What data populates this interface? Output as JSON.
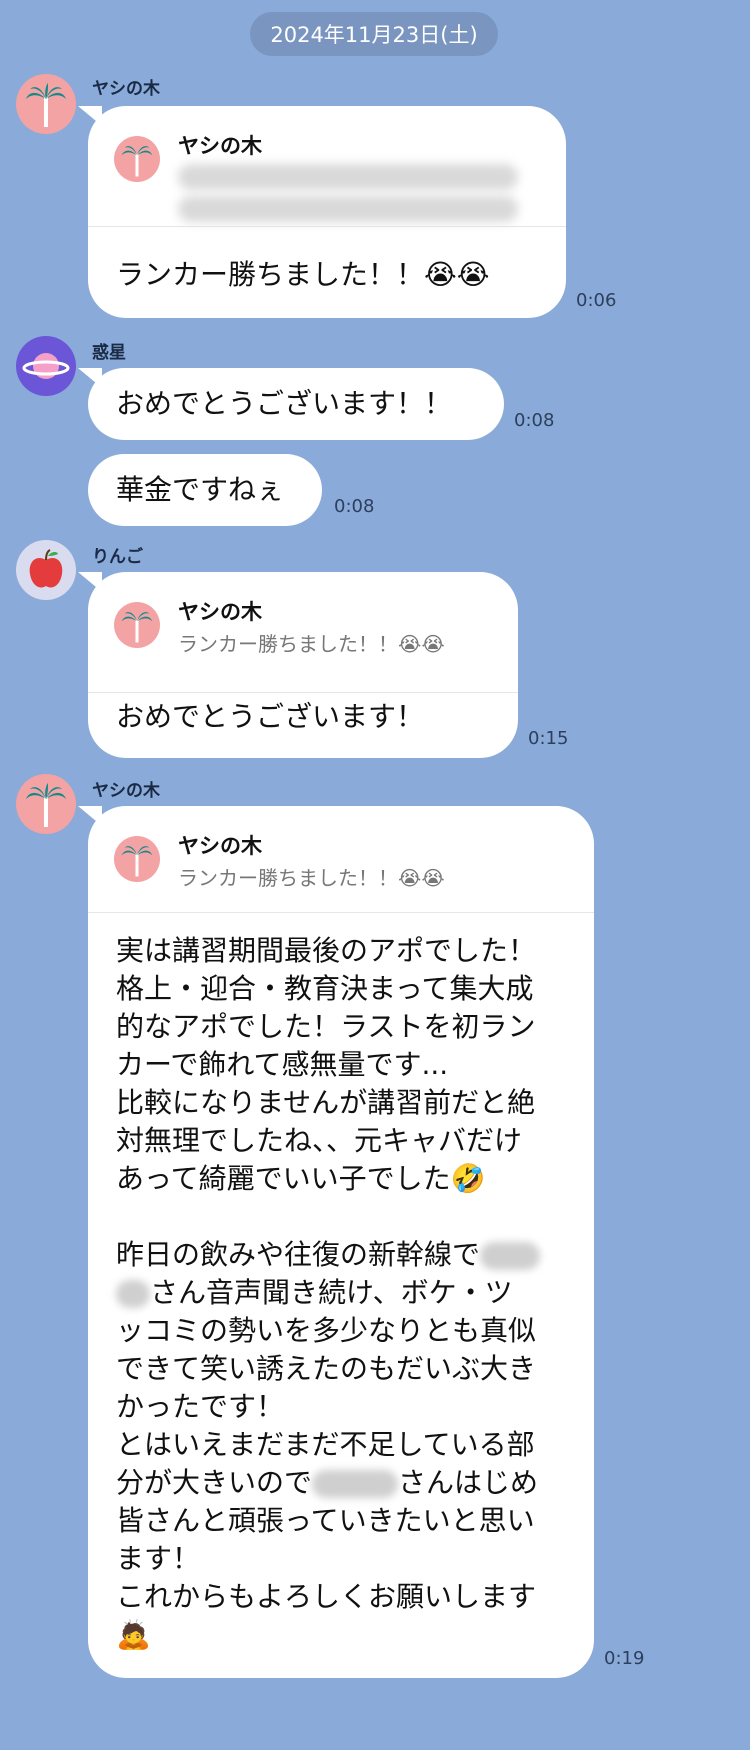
{
  "date_separator": "2024年11月23日(土)",
  "messages": [
    {
      "sender": "ヤシの木",
      "reply_name": "ヤシの木",
      "text": "ランカー勝ちました！！😭😭",
      "time": "0:06"
    },
    {
      "sender": "惑星",
      "text": "おめでとうございます！！",
      "time": "0:08"
    },
    {
      "text": "華金ですねぇ",
      "time": "0:08"
    },
    {
      "sender": "りんご",
      "reply_name": "ヤシの木",
      "reply_text": "ランカー勝ちました！！😭😭",
      "text": "おめでとうございます！",
      "time": "0:15"
    },
    {
      "sender": "ヤシの木",
      "reply_name": "ヤシの木",
      "reply_text": "ランカー勝ちました！！😭😭",
      "lines": [
        "実は講習期間最後のアポでした！",
        "格上・迎合・教育決まって集大成",
        "的なアポでした！ラストを初ラン",
        "カーで飾れて感無量です...",
        "比較になりませんが講習前だと絶",
        "対無理でしたね、、元キャバだけ",
        "あって綺麗でいい子でした🤣",
        "",
        "昨日の飲みや往復の新幹線で",
        "さん音声聞き続け、ボケ・ツ",
        "ッコミの勢いを多少なりとも真似",
        "できて笑い誘えたのもだいぶ大き",
        "かったです！",
        "とはいえまだまだ不足している部",
        "分が大きいので",
        "さんはじめ",
        "皆さんと頑張っていきたいと思い",
        "ます！",
        "これからもよろしくお願いします",
        "🙇"
      ],
      "time": "0:19"
    }
  ],
  "icons": {
    "palm": "palm-tree-icon",
    "planet": "planet-icon",
    "apple": "apple-icon"
  }
}
